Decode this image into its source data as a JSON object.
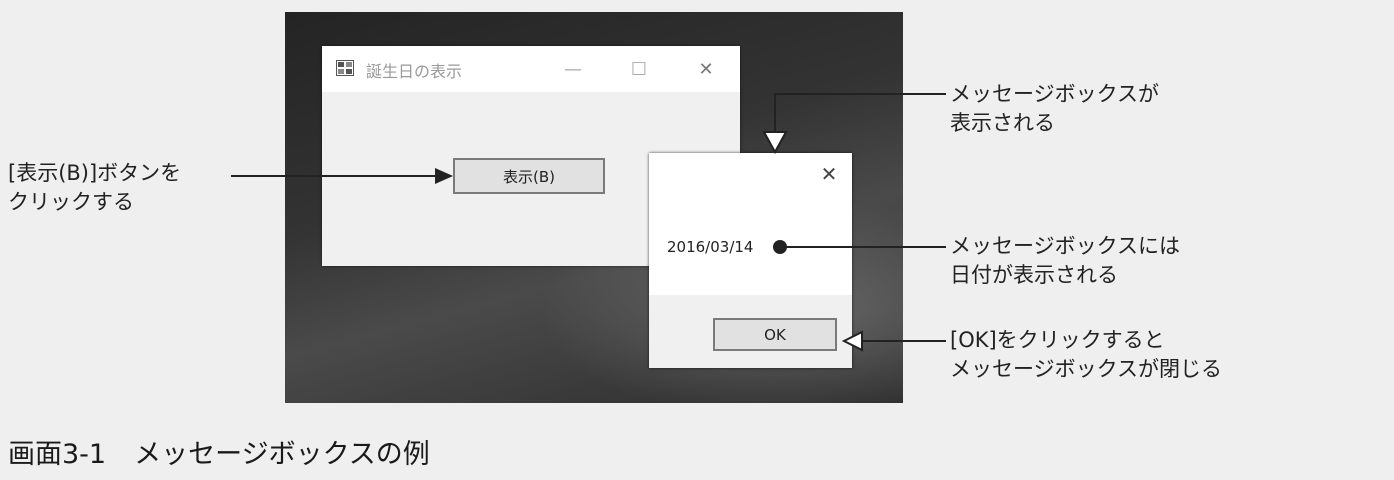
{
  "main_window": {
    "title": "誕生日の表示",
    "minimize_glyph": "—",
    "maximize_glyph": "☐",
    "close_glyph": "✕",
    "show_button_label": "表示(B)"
  },
  "message_box": {
    "close_glyph": "✕",
    "message": "2016/03/14",
    "ok_label": "OK"
  },
  "callouts": {
    "show_button": [
      "[表示(B)]ボタンを",
      "クリックする"
    ],
    "message_box_shown": [
      "メッセージボックスが",
      "表示される"
    ],
    "date_shown": [
      "メッセージボックスには",
      "日付が表示される"
    ],
    "ok_closes": [
      "[OK]をクリックすると",
      "メッセージボックスが閉じる"
    ]
  },
  "caption": {
    "number": "画面3-1",
    "title": "メッセージボックスの例"
  },
  "icons": [
    "app-icon",
    "minimize-icon",
    "maximize-icon",
    "close-icon"
  ],
  "colors": {
    "annotation": "#222222",
    "button_border": "#7a7a7a"
  }
}
